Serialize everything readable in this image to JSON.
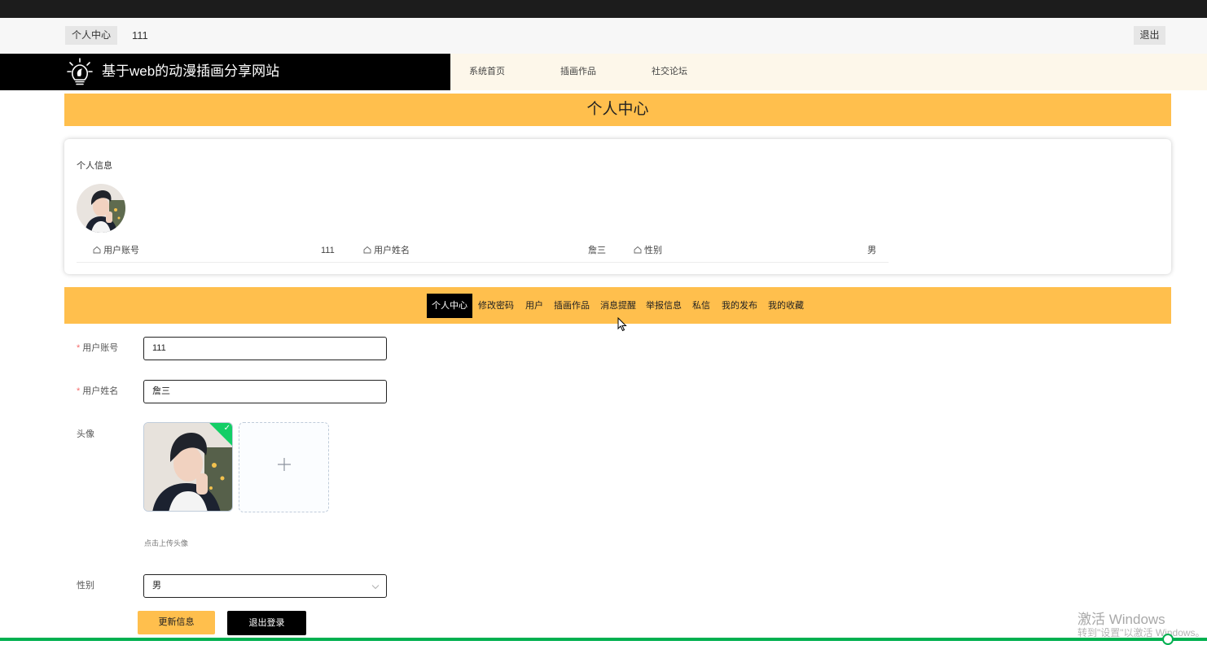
{
  "topbar": {
    "home_label": "个人中心",
    "username": "111",
    "logout_label": "退出"
  },
  "brand": {
    "title": "基于web的动漫插画分享网站"
  },
  "nav": {
    "items": [
      "系统首页",
      "插画作品",
      "社交论坛"
    ]
  },
  "banner": {
    "title": "个人中心"
  },
  "profile_card": {
    "title": "个人信息",
    "fields": [
      {
        "label": "用户账号",
        "value": "111"
      },
      {
        "label": "用户姓名",
        "value": "詹三"
      },
      {
        "label": "性别",
        "value": "男"
      }
    ]
  },
  "tabs": {
    "items": [
      "个人中心",
      "修改密码",
      "用户",
      "插画作品",
      "消息提醒",
      "举报信息",
      "私信",
      "我的发布",
      "我的收藏"
    ],
    "active": "个人中心"
  },
  "form": {
    "account_label": "用户账号",
    "account_value": "111",
    "name_label": "用户姓名",
    "name_value": "詹三",
    "avatar_label": "头像",
    "upload_tip": "点击上传头像",
    "upload_plus": "+",
    "gender_label": "性别",
    "gender_value": "男",
    "update_button": "更新信息",
    "logout_button": "退出登录"
  },
  "watermark": {
    "title": "激活 Windows",
    "subtitle": "转到\"设置\"以激活 Windows。"
  },
  "colors": {
    "accent": "#ffbf4d",
    "dark": "#000000",
    "nav_bg": "#fdf7ea",
    "success": "#13ce66",
    "progress": "#00b050"
  },
  "icons": {
    "brand": "lightbulb-icon",
    "field": "home-outline-icon",
    "select": "chevron-down-icon",
    "upload_status": "check-icon",
    "cursor": "mouse-pointer-icon"
  }
}
